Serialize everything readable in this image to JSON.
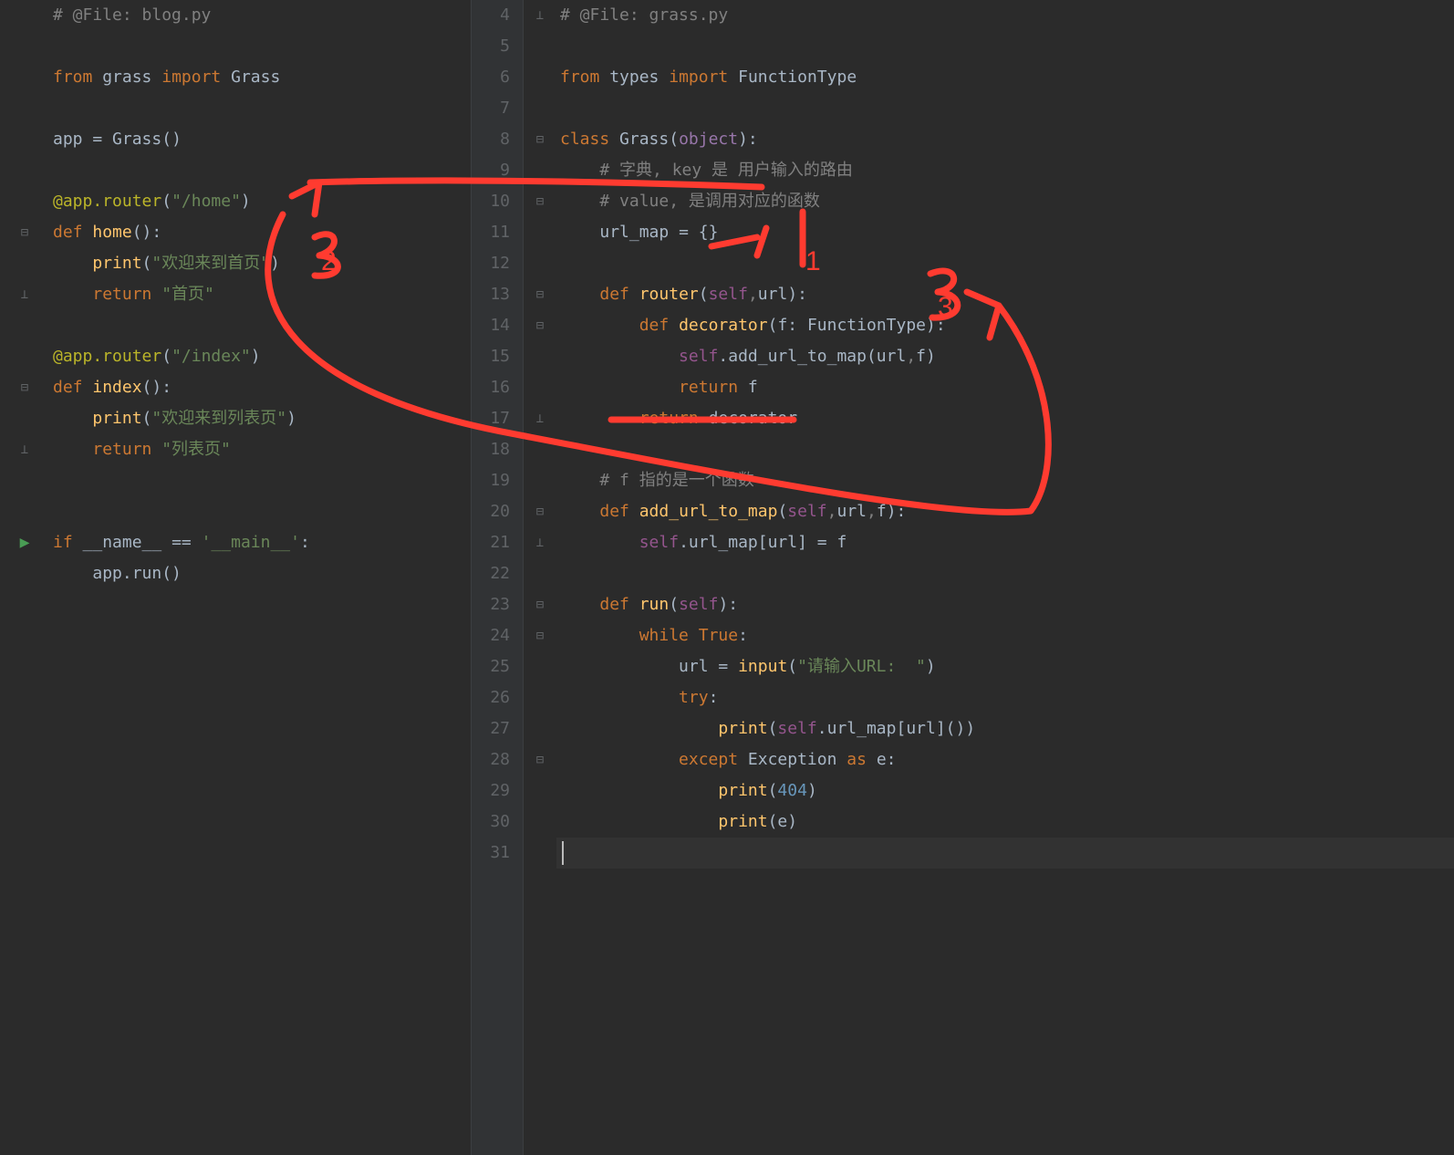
{
  "left": {
    "file_header": "# @File: blog.py",
    "lines": [
      "# @File: blog.py",
      "",
      "from grass import Grass",
      "",
      "app = Grass()",
      "",
      "@app.router(\"/home\")",
      "def home():",
      "    print(\"欢迎来到首页\")",
      "    return \"首页\"",
      "",
      "@app.router(\"/index\")",
      "def index():",
      "    print(\"欢迎来到列表页\")",
      "    return \"列表页\"",
      "",
      "",
      "if __name__ == '__main__':",
      "    app.run()"
    ]
  },
  "right": {
    "file_header": "# @File: grass.py",
    "numbers": [
      "4",
      "5",
      "6",
      "7",
      "8",
      "9",
      "10",
      "11",
      "12",
      "13",
      "14",
      "15",
      "16",
      "17",
      "18",
      "19",
      "20",
      "21",
      "22",
      "23",
      "24",
      "25",
      "26",
      "27",
      "28",
      "29",
      "30",
      "31"
    ],
    "lines": [
      "# @File: grass.py",
      "",
      "from types import FunctionType",
      "",
      "class Grass(object):",
      "    # 字典, key 是 用户输入的路由",
      "    # value, 是调用对应的函数",
      "    url_map = {}",
      "",
      "    def router(self,url):",
      "        def decorator(f: FunctionType):",
      "            self.add_url_to_map(url,f)",
      "            return f",
      "        return decorator",
      "",
      "    # f 指的是一个函数",
      "    def add_url_to_map(self,url,f):",
      "        self.url_map[url] = f",
      "",
      "    def run(self):",
      "        while True:",
      "            url = input(\"请输入URL:  \")",
      "            try:",
      "                print(self.url_map[url]())",
      "            except Exception as e:",
      "                print(404)",
      "                print(e)",
      ""
    ]
  },
  "annotations": {
    "color": "#ff3b30",
    "labels": [
      "1",
      "2",
      "3"
    ]
  }
}
